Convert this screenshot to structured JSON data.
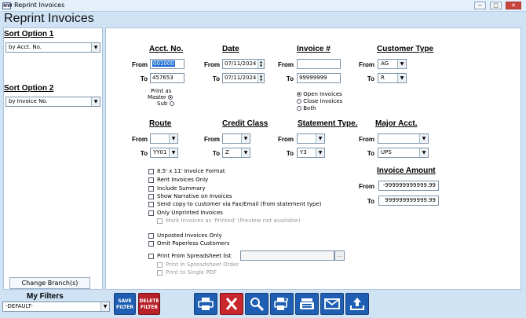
{
  "window": {
    "title": "Reprint Invoices",
    "app_icon": "NW",
    "controls": [
      "−",
      "□",
      "✕"
    ]
  },
  "page_title": "Reprint Invoices",
  "sort_option_1": {
    "label": "Sort Option 1",
    "value": "by Acct. No."
  },
  "sort_option_2": {
    "label": "Sort Option 2",
    "value": "by Invoice No."
  },
  "change_branch": "Change Branch(s)",
  "labels": {
    "from": "From",
    "to": "To"
  },
  "acct": {
    "header": "Acct. No.",
    "from": "001000",
    "to": "457653"
  },
  "date": {
    "header": "Date",
    "from": "07/11/2024",
    "to": "07/11/2024"
  },
  "invoice": {
    "header": "Invoice #",
    "from": "",
    "to": "99999999"
  },
  "customer_type": {
    "header": "Customer Type",
    "from": "AG",
    "to": "R"
  },
  "print_as": {
    "label_line1": "Print as",
    "master": "Master",
    "sub": "Sub",
    "selected": "Master"
  },
  "invoice_status": {
    "options": [
      "Open Invoices",
      "Close Invoices",
      "Both"
    ],
    "selected": "Open Invoices"
  },
  "route": {
    "header": "Route",
    "from": "",
    "to": "YY01"
  },
  "credit_class": {
    "header": "Credit Class",
    "from": "",
    "to": "Z"
  },
  "statement_type": {
    "header": "Statement Type.",
    "from": "",
    "to": "Y3"
  },
  "major_acct": {
    "header": "Major Acct.",
    "from": "",
    "to": "UPS"
  },
  "options": {
    "format": "8.5' x 11' Invoice Format",
    "rent_only": "Rent Invoices Only",
    "include_summary": "Include Summary",
    "show_narrative": "Show Narrative on Invoices",
    "send_copy": "Send copy to customer via Fax/Email (from statement type)",
    "only_unprinted": "Only Unprinted Invoices",
    "mark_printed": "Mark Invoices as 'Printed' (Preview not available)",
    "unposted_only": "Unposted Invoices Only",
    "omit_paperless": "Omit Paperless Customers",
    "print_from_spreadsheet": "Print From Spreadsheet list",
    "spreadsheet_order": "Print in Spreadsheet Order",
    "single_pdf": "Print to Single PDF",
    "spreadsheet_path": "",
    "browse": "..."
  },
  "invoice_amount": {
    "header": "Invoice Amount",
    "from": "-999999999999.99",
    "to": "999999999999.99"
  },
  "my_filters": {
    "label": "My Filters",
    "value": "-DEFAULT-"
  },
  "buttons": {
    "save_filter": [
      "SAVE",
      "FILTER"
    ],
    "delete_filter": [
      "DELETE",
      "FILTER"
    ]
  },
  "toolbar_icons": [
    "print-icon",
    "cancel-icon",
    "preview-icon",
    "print-setup-icon",
    "fax-icon",
    "email-icon",
    "export-icon"
  ],
  "colors": {
    "accent": "#1f5fb3",
    "danger": "#c9262e",
    "background": "#cfe3f5"
  }
}
